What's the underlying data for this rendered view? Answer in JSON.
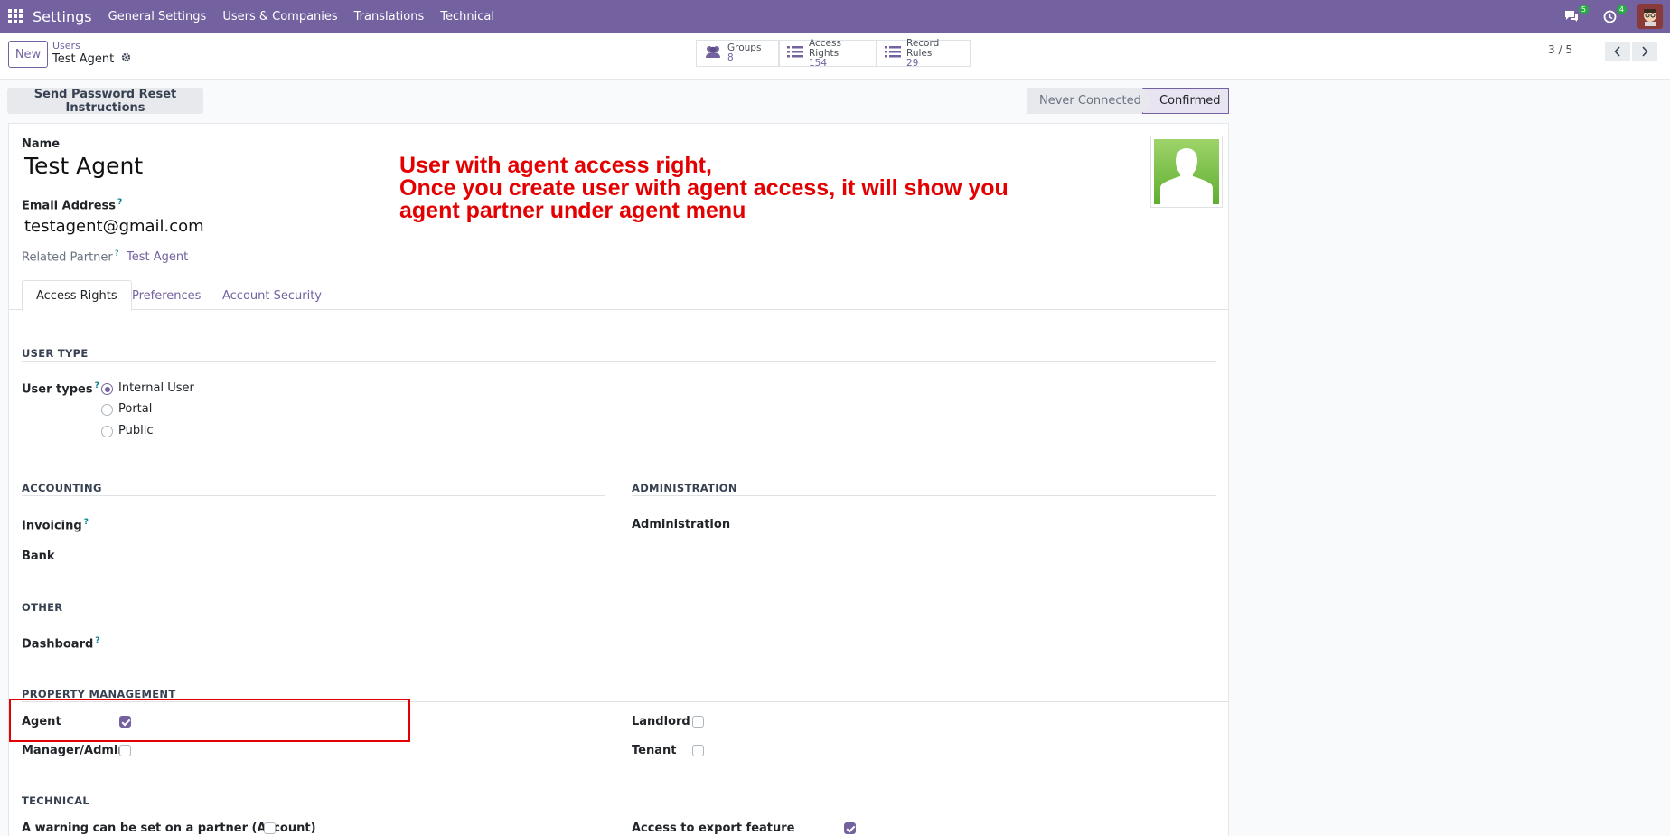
{
  "topbar": {
    "app_name": "Settings",
    "menu": [
      "General Settings",
      "Users & Companies",
      "Translations",
      "Technical"
    ],
    "messages_badge": "5",
    "activities_badge": "4"
  },
  "control": {
    "new_label": "New",
    "breadcrumb_parent": "Users",
    "breadcrumb_current": "Test Agent",
    "stats": [
      {
        "label": "Groups",
        "value": "8",
        "icon": "users-icon"
      },
      {
        "label": "Access Rights",
        "value": "154",
        "icon": "list-icon"
      },
      {
        "label": "Record Rules",
        "value": "29",
        "icon": "list-icon"
      }
    ],
    "pager": "3 / 5"
  },
  "status_bar": {
    "reset_label": "Send Password Reset Instructions",
    "states": [
      "Never Connected",
      "Confirmed"
    ],
    "active_state": "Confirmed"
  },
  "form": {
    "name_label": "Name",
    "name_value": "Test Agent",
    "email_label": "Email Address",
    "email_value": "testagent@gmail.com",
    "partner_label": "Related Partner",
    "partner_value": "Test Agent",
    "annotation": [
      "User with agent access right,",
      "Once you create user with agent access, it will show you",
      "agent partner under agent menu"
    ]
  },
  "tabs": [
    "Access Rights",
    "Preferences",
    "Account Security"
  ],
  "access": {
    "user_type_section": "USER TYPE",
    "user_types_label": "User types",
    "user_types": [
      "Internal User",
      "Portal",
      "Public"
    ],
    "user_type_selected": "Internal User",
    "accounting_section": "ACCOUNTING",
    "invoicing_label": "Invoicing",
    "bank_label": "Bank",
    "administration_section": "ADMINISTRATION",
    "administration_label": "Administration",
    "other_section": "OTHER",
    "dashboard_label": "Dashboard",
    "property_section": "PROPERTY MANAGEMENT",
    "agent_label": "Agent",
    "agent_checked": true,
    "manager_label": "Manager/Admin",
    "manager_checked": false,
    "landlord_label": "Landlord",
    "landlord_checked": false,
    "tenant_label": "Tenant",
    "tenant_checked": false,
    "technical_section": "TECHNICAL",
    "warning_label": "A warning can be set on a partner (Account)",
    "warning_checked": false,
    "export_label": "Access to export feature",
    "export_checked": true
  },
  "colors": {
    "brand": "#73629f",
    "annotation": "#e40000"
  }
}
